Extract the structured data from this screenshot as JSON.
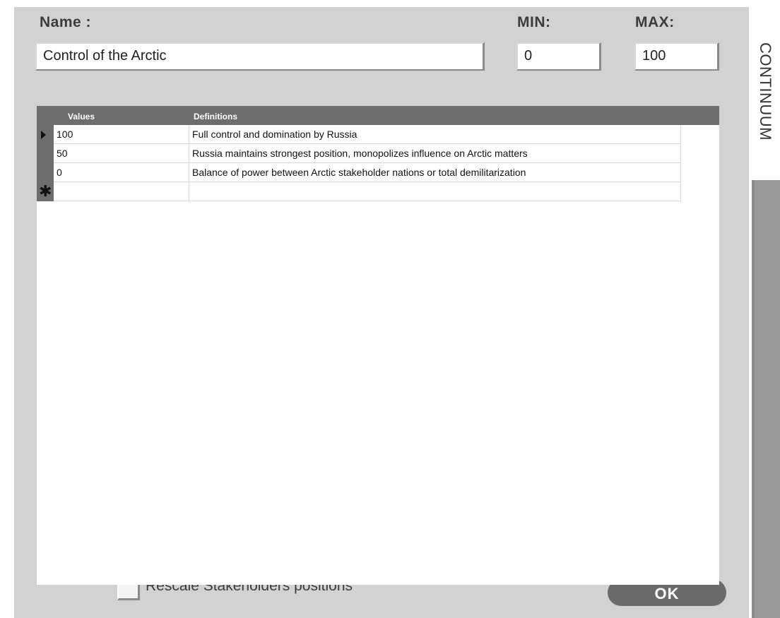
{
  "header": {
    "name_label": "Name :",
    "min_label": "MIN:",
    "max_label": "MAX:"
  },
  "fields": {
    "name_value": "Control of the Arctic",
    "min_value": "0",
    "max_value": "100"
  },
  "side_tab": {
    "label": "CONTINUUM"
  },
  "grid": {
    "columns": [
      "Values",
      "Definitions"
    ],
    "rows": [
      {
        "value": "100",
        "definition": "Full control and domination by Russia"
      },
      {
        "value": "50",
        "definition": "Russia maintains strongest position, monopolizes influence on Arctic matters"
      },
      {
        "value": "0",
        "definition": "Balance of power between Arctic stakeholder nations or total demilitarization"
      },
      {
        "value": "",
        "definition": ""
      }
    ],
    "current_row_marker": "arrow-right-icon",
    "new_row_marker": "asterisk-icon"
  },
  "footer": {
    "checkbox_label": "Rescale Stakeholders positions",
    "checkbox_checked": false,
    "ok_label": "OK"
  },
  "colors": {
    "panel_bg": "#d2d2d2",
    "grid_header_bg": "#6e6e6e",
    "button_bg": "#6b6b6b"
  }
}
